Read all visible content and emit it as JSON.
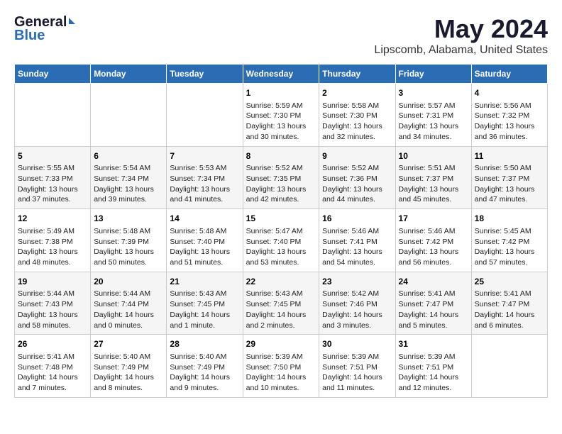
{
  "header": {
    "logo_general": "General",
    "logo_blue": "Blue",
    "title": "May 2024",
    "subtitle": "Lipscomb, Alabama, United States"
  },
  "days_of_week": [
    "Sunday",
    "Monday",
    "Tuesday",
    "Wednesday",
    "Thursday",
    "Friday",
    "Saturday"
  ],
  "weeks": [
    [
      {
        "day": "",
        "info": ""
      },
      {
        "day": "",
        "info": ""
      },
      {
        "day": "",
        "info": ""
      },
      {
        "day": "1",
        "info": "Sunrise: 5:59 AM\nSunset: 7:30 PM\nDaylight: 13 hours\nand 30 minutes."
      },
      {
        "day": "2",
        "info": "Sunrise: 5:58 AM\nSunset: 7:30 PM\nDaylight: 13 hours\nand 32 minutes."
      },
      {
        "day": "3",
        "info": "Sunrise: 5:57 AM\nSunset: 7:31 PM\nDaylight: 13 hours\nand 34 minutes."
      },
      {
        "day": "4",
        "info": "Sunrise: 5:56 AM\nSunset: 7:32 PM\nDaylight: 13 hours\nand 36 minutes."
      }
    ],
    [
      {
        "day": "5",
        "info": "Sunrise: 5:55 AM\nSunset: 7:33 PM\nDaylight: 13 hours\nand 37 minutes."
      },
      {
        "day": "6",
        "info": "Sunrise: 5:54 AM\nSunset: 7:34 PM\nDaylight: 13 hours\nand 39 minutes."
      },
      {
        "day": "7",
        "info": "Sunrise: 5:53 AM\nSunset: 7:34 PM\nDaylight: 13 hours\nand 41 minutes."
      },
      {
        "day": "8",
        "info": "Sunrise: 5:52 AM\nSunset: 7:35 PM\nDaylight: 13 hours\nand 42 minutes."
      },
      {
        "day": "9",
        "info": "Sunrise: 5:52 AM\nSunset: 7:36 PM\nDaylight: 13 hours\nand 44 minutes."
      },
      {
        "day": "10",
        "info": "Sunrise: 5:51 AM\nSunset: 7:37 PM\nDaylight: 13 hours\nand 45 minutes."
      },
      {
        "day": "11",
        "info": "Sunrise: 5:50 AM\nSunset: 7:37 PM\nDaylight: 13 hours\nand 47 minutes."
      }
    ],
    [
      {
        "day": "12",
        "info": "Sunrise: 5:49 AM\nSunset: 7:38 PM\nDaylight: 13 hours\nand 48 minutes."
      },
      {
        "day": "13",
        "info": "Sunrise: 5:48 AM\nSunset: 7:39 PM\nDaylight: 13 hours\nand 50 minutes."
      },
      {
        "day": "14",
        "info": "Sunrise: 5:48 AM\nSunset: 7:40 PM\nDaylight: 13 hours\nand 51 minutes."
      },
      {
        "day": "15",
        "info": "Sunrise: 5:47 AM\nSunset: 7:40 PM\nDaylight: 13 hours\nand 53 minutes."
      },
      {
        "day": "16",
        "info": "Sunrise: 5:46 AM\nSunset: 7:41 PM\nDaylight: 13 hours\nand 54 minutes."
      },
      {
        "day": "17",
        "info": "Sunrise: 5:46 AM\nSunset: 7:42 PM\nDaylight: 13 hours\nand 56 minutes."
      },
      {
        "day": "18",
        "info": "Sunrise: 5:45 AM\nSunset: 7:42 PM\nDaylight: 13 hours\nand 57 minutes."
      }
    ],
    [
      {
        "day": "19",
        "info": "Sunrise: 5:44 AM\nSunset: 7:43 PM\nDaylight: 13 hours\nand 58 minutes."
      },
      {
        "day": "20",
        "info": "Sunrise: 5:44 AM\nSunset: 7:44 PM\nDaylight: 14 hours\nand 0 minutes."
      },
      {
        "day": "21",
        "info": "Sunrise: 5:43 AM\nSunset: 7:45 PM\nDaylight: 14 hours\nand 1 minute."
      },
      {
        "day": "22",
        "info": "Sunrise: 5:43 AM\nSunset: 7:45 PM\nDaylight: 14 hours\nand 2 minutes."
      },
      {
        "day": "23",
        "info": "Sunrise: 5:42 AM\nSunset: 7:46 PM\nDaylight: 14 hours\nand 3 minutes."
      },
      {
        "day": "24",
        "info": "Sunrise: 5:41 AM\nSunset: 7:47 PM\nDaylight: 14 hours\nand 5 minutes."
      },
      {
        "day": "25",
        "info": "Sunrise: 5:41 AM\nSunset: 7:47 PM\nDaylight: 14 hours\nand 6 minutes."
      }
    ],
    [
      {
        "day": "26",
        "info": "Sunrise: 5:41 AM\nSunset: 7:48 PM\nDaylight: 14 hours\nand 7 minutes."
      },
      {
        "day": "27",
        "info": "Sunrise: 5:40 AM\nSunset: 7:49 PM\nDaylight: 14 hours\nand 8 minutes."
      },
      {
        "day": "28",
        "info": "Sunrise: 5:40 AM\nSunset: 7:49 PM\nDaylight: 14 hours\nand 9 minutes."
      },
      {
        "day": "29",
        "info": "Sunrise: 5:39 AM\nSunset: 7:50 PM\nDaylight: 14 hours\nand 10 minutes."
      },
      {
        "day": "30",
        "info": "Sunrise: 5:39 AM\nSunset: 7:51 PM\nDaylight: 14 hours\nand 11 minutes."
      },
      {
        "day": "31",
        "info": "Sunrise: 5:39 AM\nSunset: 7:51 PM\nDaylight: 14 hours\nand 12 minutes."
      },
      {
        "day": "",
        "info": ""
      }
    ]
  ]
}
